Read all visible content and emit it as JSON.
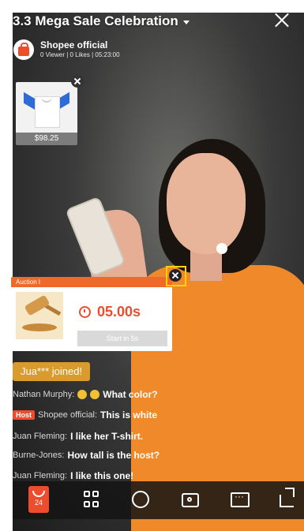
{
  "header": {
    "title": "3.3 Mega Sale Celebration",
    "shop_name": "Shopee official",
    "stats": "0 Viewer | 0 Likes | 05:23:00"
  },
  "product": {
    "price": "$98.25"
  },
  "auction": {
    "label": "Auction I",
    "timer": "05.00s",
    "start_label": "Start in 5s"
  },
  "chat": {
    "joined": "Jua*** joined!",
    "messages": [
      {
        "name": "Nathan Murphy:",
        "text": "What color?",
        "emojis": 2
      },
      {
        "badge": "Host",
        "name": "Shopee official:",
        "text": "This is white"
      },
      {
        "name": "Juan Fleming:",
        "text": "I like her T-shirt."
      },
      {
        "name": "Burne-Jones:",
        "text": "How tall is the host?"
      },
      {
        "name": "Juan Fleming:",
        "text": "I like this one!"
      }
    ]
  },
  "bottom_bar": {
    "cart_count": "24"
  },
  "colors": {
    "brand": "#ee4d2d",
    "auction_header": "#ee6a2b",
    "joined_bg": "#d99a2e",
    "highlight": "#ffd400"
  }
}
